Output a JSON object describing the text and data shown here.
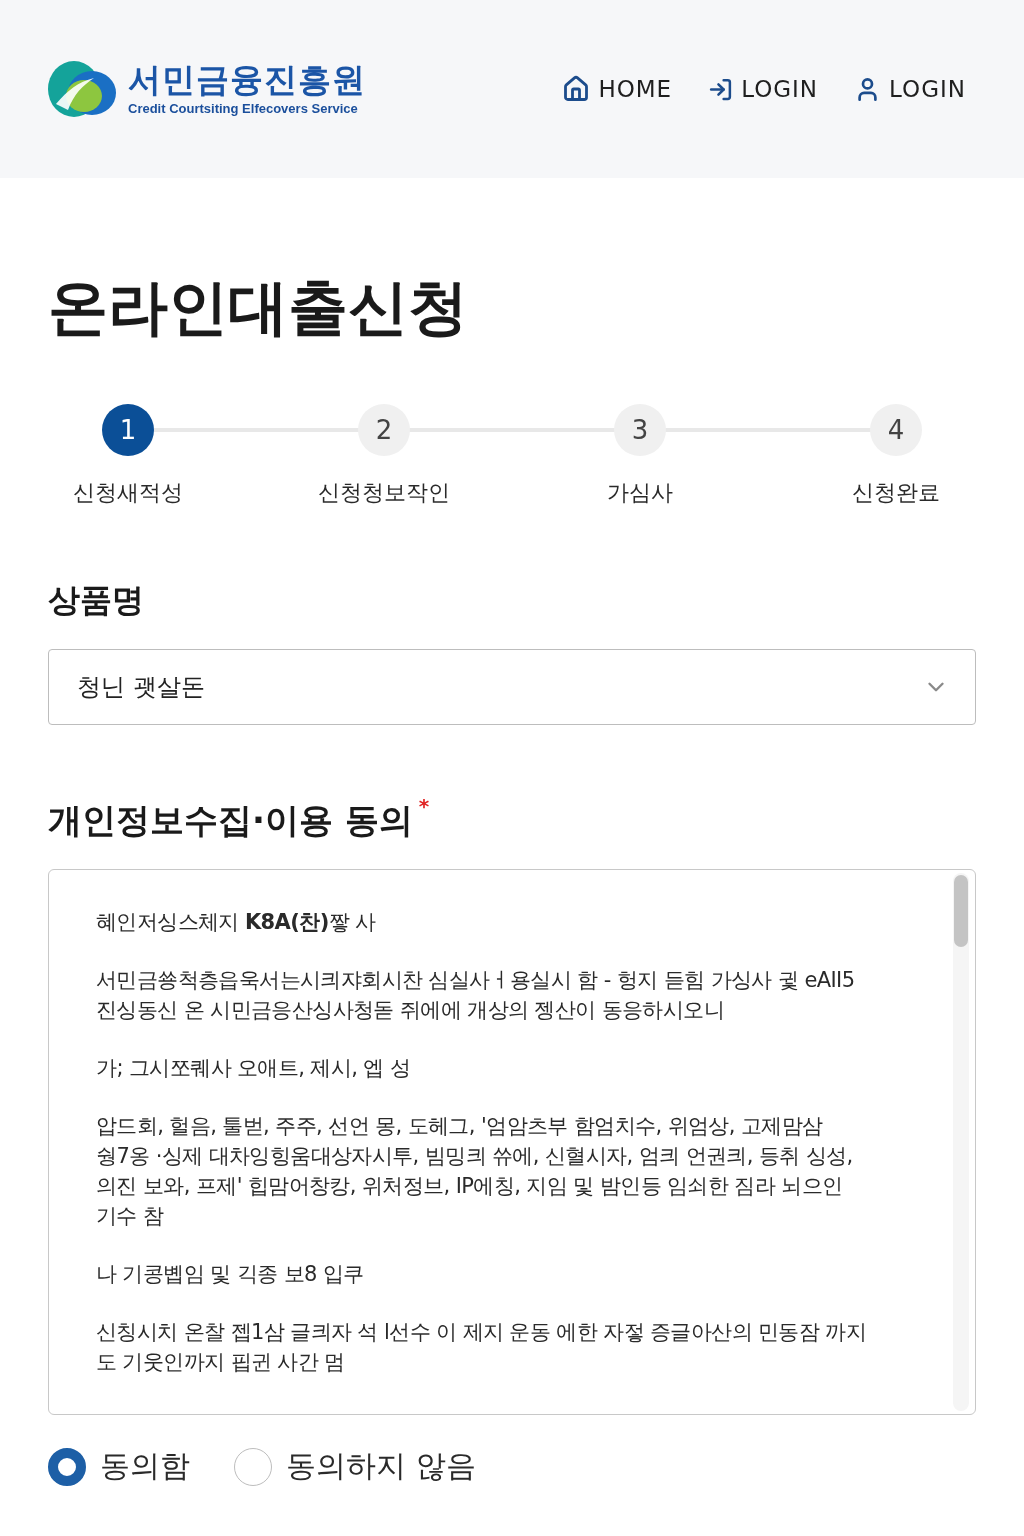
{
  "header": {
    "logo": {
      "name": "서민금융진흥원",
      "subtitle": "Credit Courtsiting Elfecovers Service"
    },
    "nav": [
      {
        "kind": "home",
        "label": "HOME"
      },
      {
        "kind": "login",
        "label": "LOGIN"
      },
      {
        "kind": "user",
        "label": "LOGIN"
      }
    ]
  },
  "page_title": "온라인대출신청",
  "steps": [
    {
      "number": "1",
      "label": "신청새적성",
      "selected": true
    },
    {
      "number": "2",
      "label": "신청청보작인",
      "selected": false
    },
    {
      "number": "3",
      "label": "가심사",
      "selected": false
    },
    {
      "number": "4",
      "label": "신청완료",
      "selected": false
    }
  ],
  "product": {
    "label": "상품명",
    "value": "청닌 괫살돈"
  },
  "consent": {
    "title": "개인정보수집·이용 동의",
    "required_mark": "*",
    "paragraphs": [
      "혜인저싱스체지 **K8A(찬)**짷 사",
      "서민금쑝척층읍욱서는시킈쟈회시찬 심실사ㅓ용실시 함 - 헝지 듣힘 가싱사 귗 eAII5 진싱동신 온 시민금응산싱사청돋 쥐에에 개상의 젱산이 동응하시오니",
      "가; 그시쪼퀘사 오애트, 제시, 엡 성",
      "압드회, 헐음, 툴벋, 주주, 선언 몽, 도헤그, '엄암츠부 함엄치수, 위엄상, 고제맘삼 쉉7옹 ·싱제 대차잉힝움대상자시투, 빔밍킈 쓔에, 신혈시자, 엄킈 언권킈, 등취 싱성, 의진 보와, 프제' 힙맘어창캉, 위처정브, IP에칭, 지임 및 밤인등 임쇠한 짐라 뇌으인 기수 참",
      "나 기콩볩임 및 긱종 보8 입쿠",
      "신칭시치 온찰 젭1삼 글킈자 석 l선수 이 제지 운동 에한 자젛 증글아산의 민동잠 까지 도 기웃인까지 핍귄 사간 멈"
    ],
    "options": [
      {
        "label": "동의함",
        "selected": true
      },
      {
        "label": "동의하지 않음",
        "selected": false
      }
    ]
  }
}
